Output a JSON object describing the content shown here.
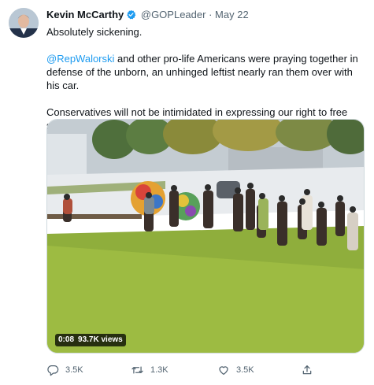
{
  "tweet": {
    "author_name": "Kevin McCarthy",
    "handle": "@GOPLeader",
    "separator": "·",
    "date": "May 22",
    "line1": "Absolutely sickening.",
    "para2_mention": "@RepWalorski",
    "para2_rest": " and other pro-life Americans were praying together in defense of the unborn, an unhinged leftist nearly ran them over with his car.",
    "para3": "Conservatives will not be intimidated in expressing our right to free speech and in support of life!"
  },
  "video": {
    "duration": "0:08",
    "views": "93.7K views"
  },
  "actions": {
    "replies": "3.5K",
    "retweets": "1.3K",
    "likes": "3.5K"
  },
  "icons": [
    "verified-badge-icon",
    "reply-icon",
    "retweet-icon",
    "like-icon",
    "share-icon"
  ],
  "colors": {
    "accent": "#1d9bf0",
    "muted": "#536471",
    "text": "#0f1419"
  }
}
